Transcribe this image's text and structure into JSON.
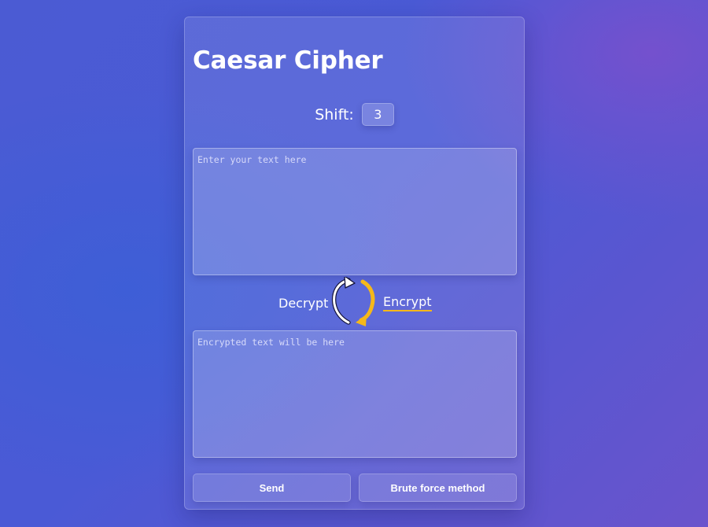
{
  "app": {
    "title": "Caesar Cipher"
  },
  "shift": {
    "label": "Shift:",
    "value": "3"
  },
  "input": {
    "value": "",
    "placeholder": "Enter your text here"
  },
  "mode": {
    "decrypt_label": "Decrypt",
    "encrypt_label": "Encrypt",
    "active": "Encrypt",
    "toggle_icon": "swap-arrows-icon",
    "accent_color": "#f5b81a"
  },
  "output": {
    "value": "",
    "placeholder": "Encrypted text will be here"
  },
  "buttons": {
    "send_label": "Send",
    "brute_force_label": "Brute force method"
  }
}
